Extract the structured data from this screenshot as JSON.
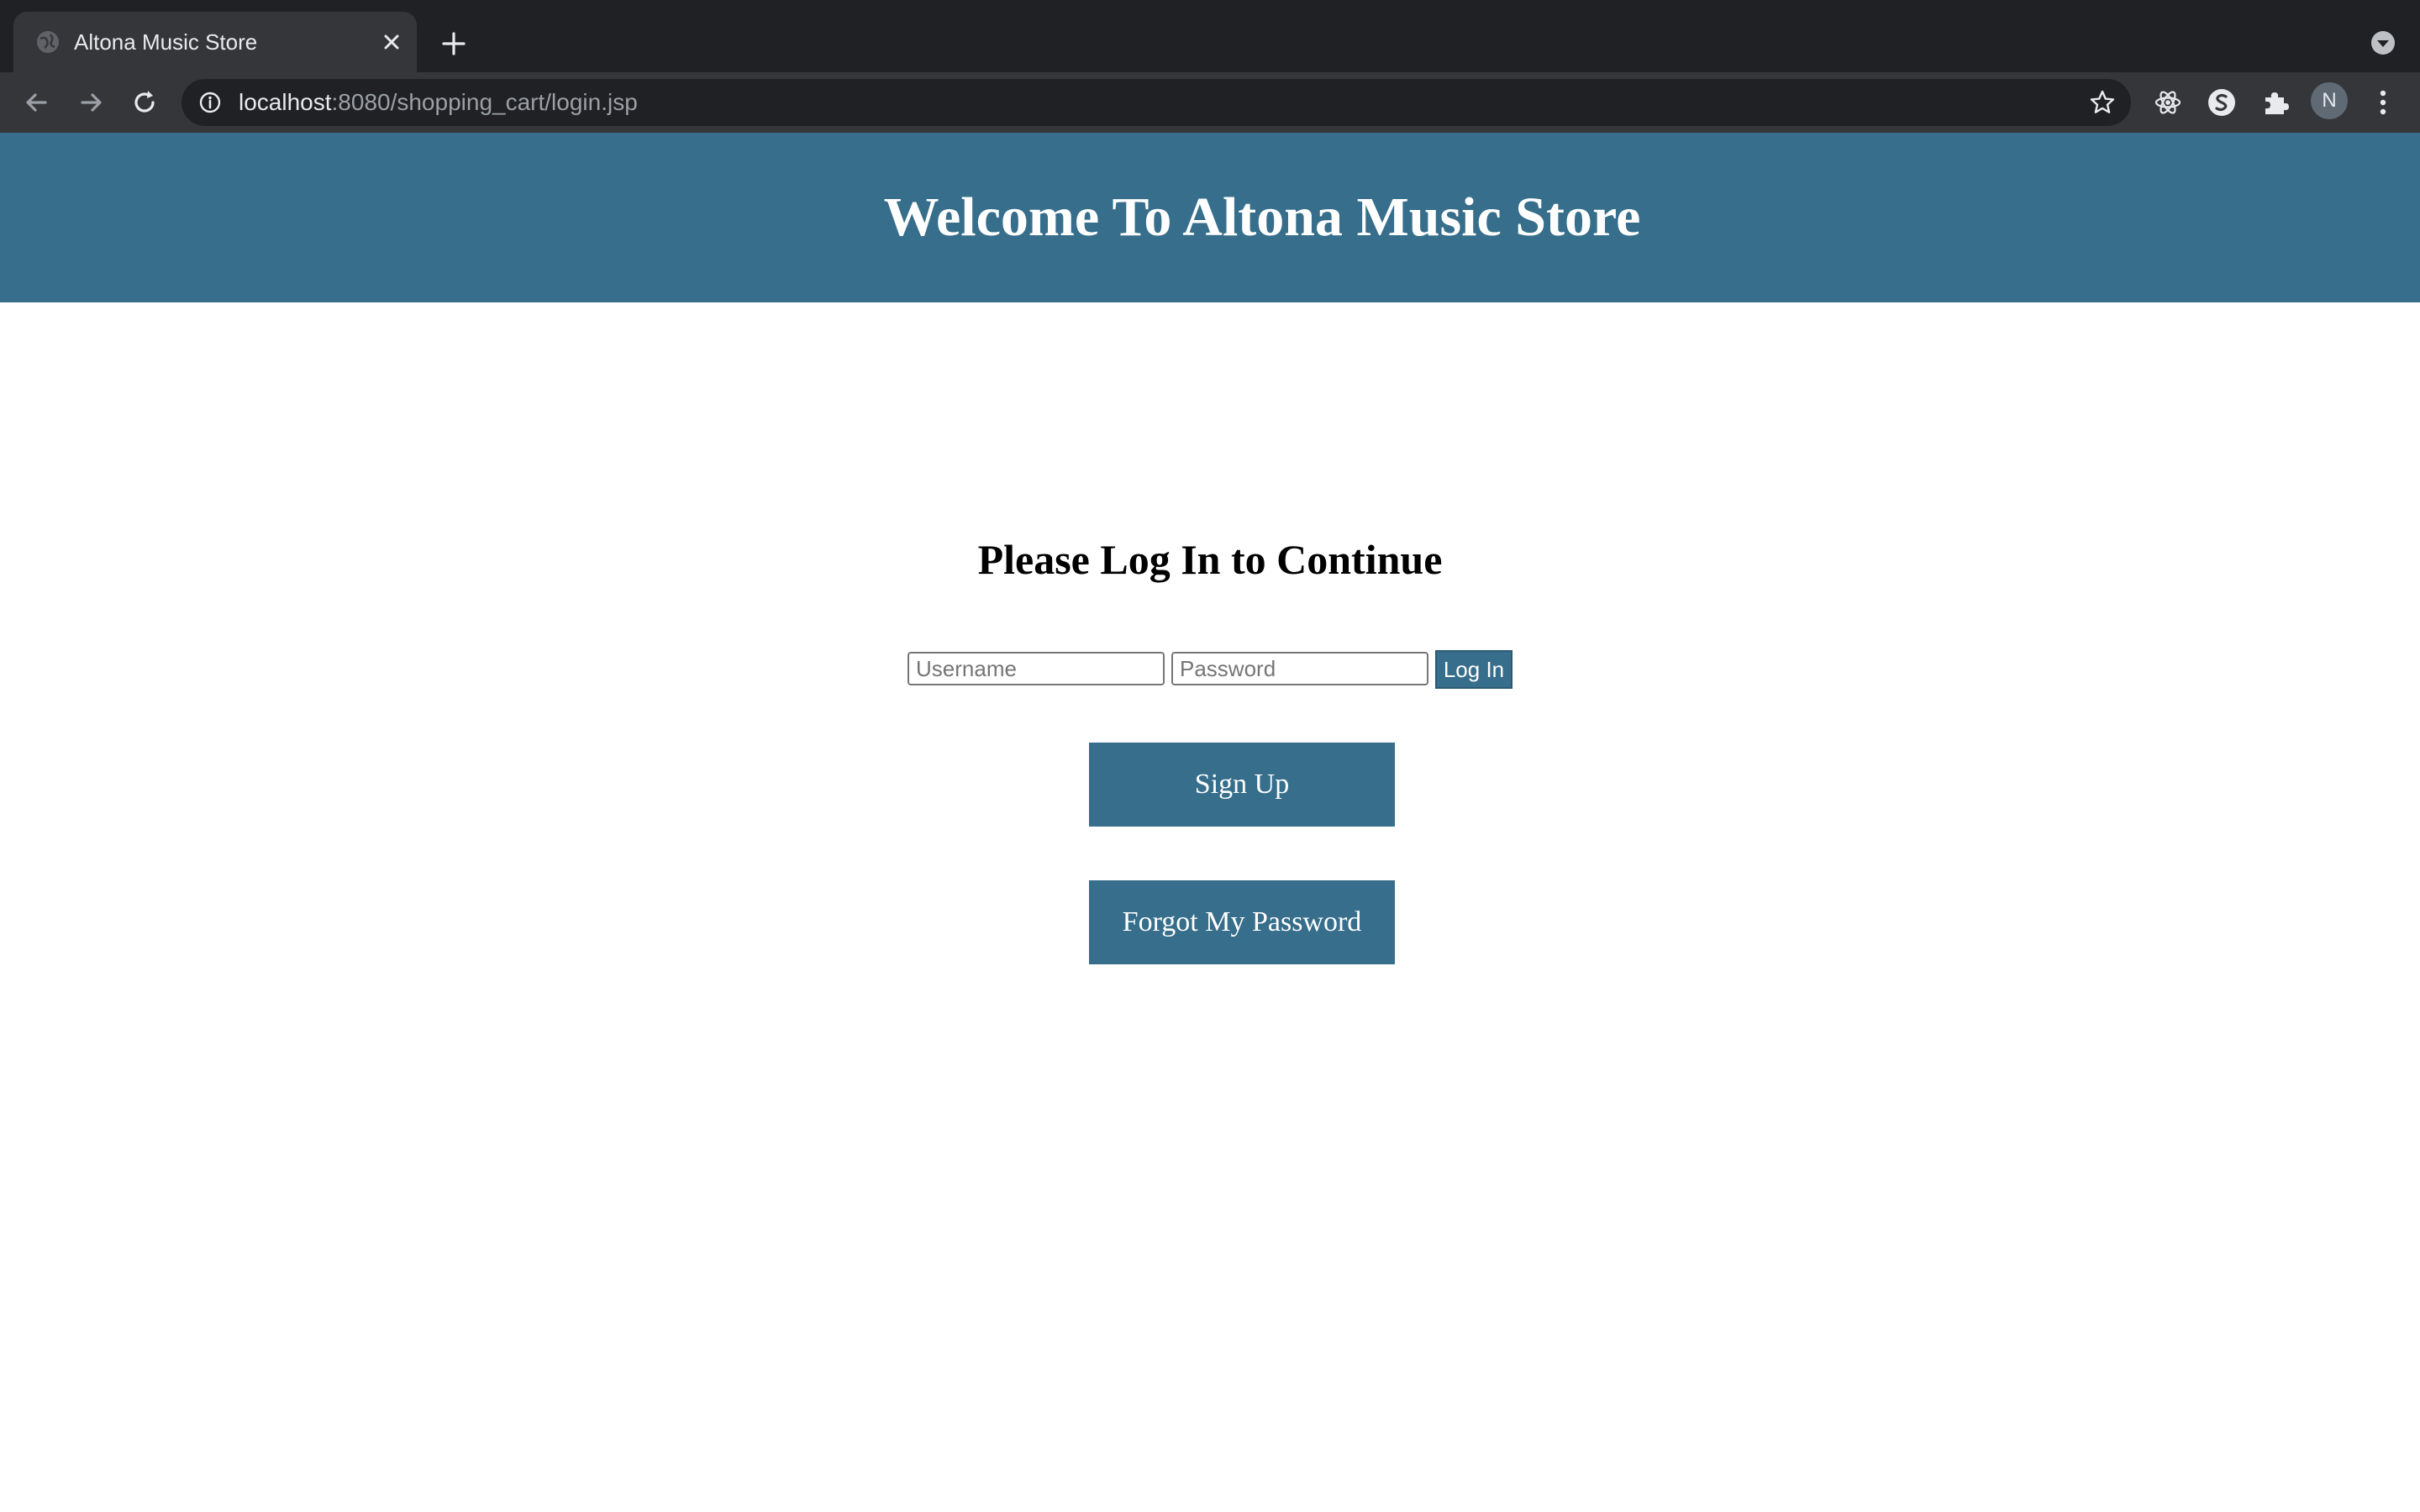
{
  "browser": {
    "tab": {
      "title": "Altona Music Store",
      "favicon": "globe-icon"
    },
    "address_bar": {
      "host": "localhost",
      "path": ":8080/shopping_cart/login.jsp"
    },
    "profile_initial": "N",
    "icons": [
      "back-icon",
      "forward-icon",
      "reload-icon",
      "info-icon",
      "star-icon",
      "react-devtools-icon",
      "s-extension-icon",
      "puzzle-icon",
      "menu-icon"
    ]
  },
  "header": {
    "title": "Welcome To Altona Music Store",
    "background_color": "#366e8b"
  },
  "login": {
    "heading": "Please Log In to Continue",
    "username_placeholder": "Username",
    "password_placeholder": "Password",
    "login_label": "Log In"
  },
  "actions": {
    "signup_label": "Sign Up",
    "forgot_label": "Forgot My Password"
  },
  "colors": {
    "accent": "#366e8b",
    "chrome_dark": "#202124",
    "chrome_toolbar": "#35363a"
  }
}
